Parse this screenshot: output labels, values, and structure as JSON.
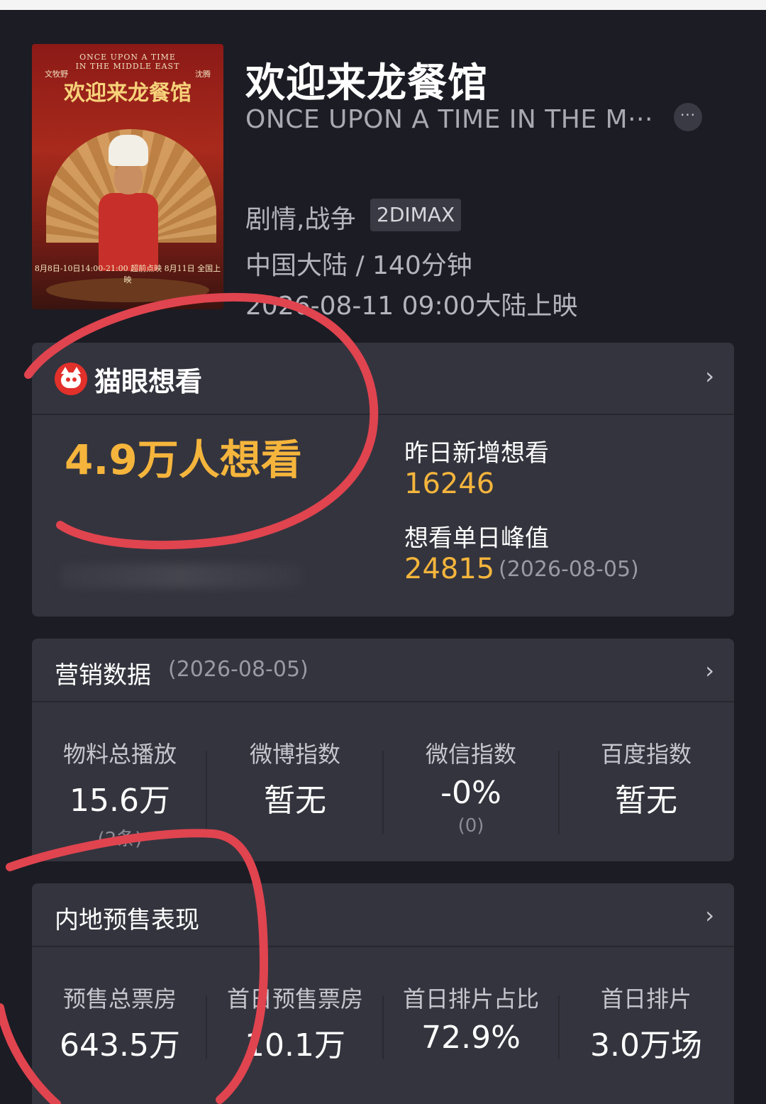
{
  "movie": {
    "title": "欢迎来龙餐馆",
    "subtitle": "ONCE UPON A TIME IN THE M···",
    "more_icon": "···",
    "genre": "剧情,战争",
    "format": "2DIMAX",
    "region_duration": "中国大陆 / 140分钟",
    "release": "2026-08-11 09:00大陆上映"
  },
  "poster": {
    "title": "欢迎来龙餐馆",
    "arc_text": "ONCE UPON A TIME IN THE MIDDLE EAST",
    "left_credit": "文牧野",
    "right_credit": "沈腾",
    "date_text": "8月8日-10日14:00-21:00 超前点映  8月11日 全国上映"
  },
  "want": {
    "brand": "猫眼想看",
    "count": "4.9万人想看",
    "yesterday_label": "昨日新增想看",
    "yesterday_value": "16246",
    "peak_label": "想看单日峰值",
    "peak_value": "24815",
    "peak_date": "(2026-08-05)",
    "chevron": "›"
  },
  "marketing": {
    "title": "营销数据",
    "date": "(2026-08-05)",
    "chevron": "›",
    "metrics": [
      {
        "label": "物料总播放",
        "value": "15.6万",
        "sub": "(2条)"
      },
      {
        "label": "微博指数",
        "value": "暂无",
        "sub": ""
      },
      {
        "label": "微信指数",
        "value": "-0%",
        "sub": "(0)"
      },
      {
        "label": "百度指数",
        "value": "暂无",
        "sub": ""
      }
    ]
  },
  "presale": {
    "title": "内地预售表现",
    "chevron": "›",
    "metrics": [
      {
        "label": "预售总票房",
        "value": "643.5万"
      },
      {
        "label": "首日预售票房",
        "value": "10.1万"
      },
      {
        "label": "首日排片占比",
        "value": "72.9%"
      },
      {
        "label": "首日排片",
        "value": "3.0万场"
      }
    ]
  },
  "colors": {
    "accent": "#f5b53c",
    "card": "#34343e",
    "background": "#1c1c24",
    "annotation": "#e0444f"
  }
}
